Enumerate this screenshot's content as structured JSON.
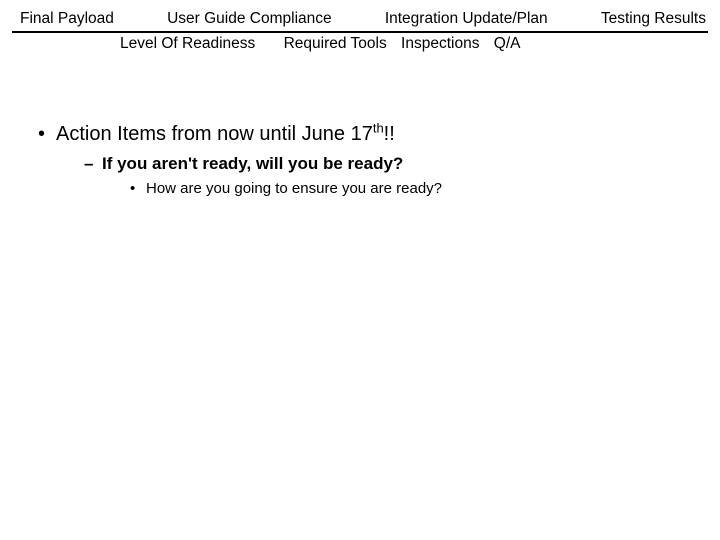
{
  "header": {
    "row1": {
      "c1": "Final Payload",
      "c2": "User Guide Compliance",
      "c3": "Integration Update/Plan",
      "c4": "Testing Results"
    },
    "row2": {
      "c1": "Level Of Readiness",
      "c2": "Required Tools",
      "c3": "Inspections",
      "c4": "Q/A"
    }
  },
  "body": {
    "line1_pre": "Action Items from now until June 17",
    "line1_sup": "th",
    "line1_post": "!!",
    "line2": "If you aren't ready, will you be ready?",
    "line3": "How are you going to ensure you are ready?"
  }
}
